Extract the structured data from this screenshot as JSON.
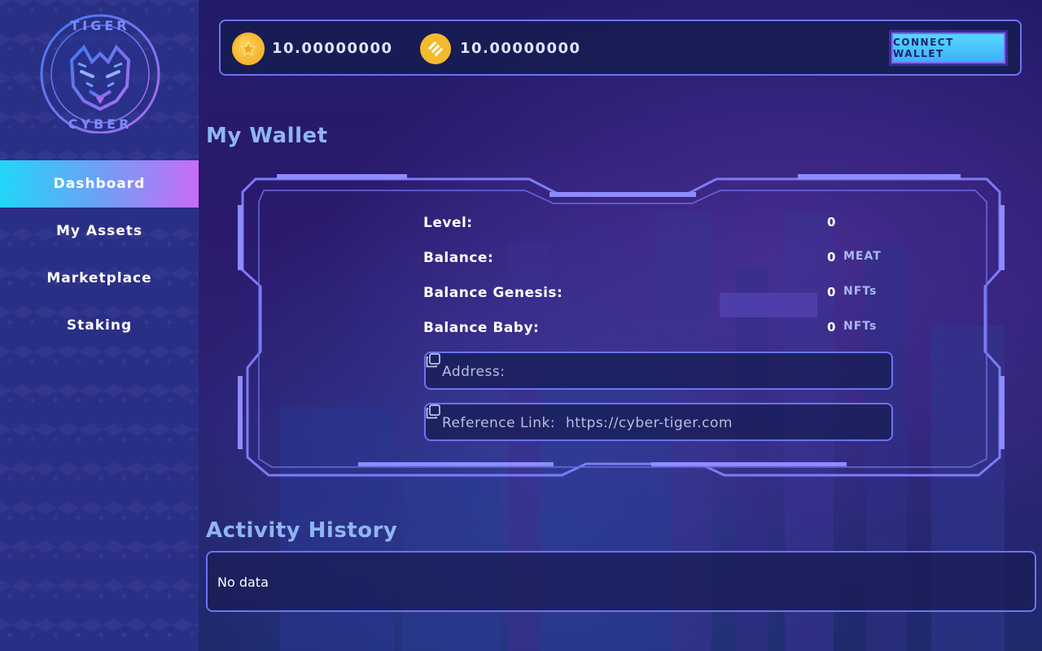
{
  "brand": {
    "logo_top_text": "TIGER",
    "logo_bottom_text": "CYBER",
    "accent_color": "#6c74f0"
  },
  "sidebar": {
    "items": [
      {
        "label": "Dashboard",
        "active": true
      },
      {
        "label": "My Assets",
        "active": false
      },
      {
        "label": "Marketplace",
        "active": false
      },
      {
        "label": "Staking",
        "active": false
      }
    ]
  },
  "header": {
    "token1": {
      "icon": "gold-coin-icon",
      "value": "10.00000000"
    },
    "token2": {
      "icon": "bnb-coin-icon",
      "value": "10.00000000"
    },
    "connect_label": "CONNECT WALLET"
  },
  "wallet": {
    "title": "My Wallet",
    "stats": [
      {
        "label": "Level:",
        "value": "0",
        "unit": ""
      },
      {
        "label": "Balance:",
        "value": "0",
        "unit": "MEAT"
      },
      {
        "label": "Balance Genesis:",
        "value": "0",
        "unit": "NFTs"
      },
      {
        "label": "Balance Baby:",
        "value": "0",
        "unit": "NFTs"
      }
    ],
    "address_label": "Address:",
    "address_value": "",
    "reference_label": "Reference Link:",
    "reference_value": "https://cyber-tiger.com"
  },
  "activity": {
    "title": "Activity History",
    "empty_text": "No data"
  }
}
